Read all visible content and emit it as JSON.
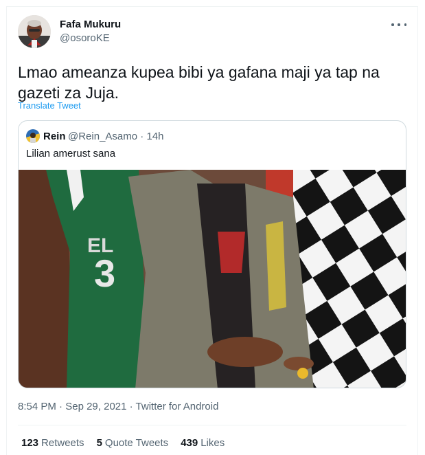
{
  "author": {
    "name": "Fafa Mukuru",
    "handle": "@osoroKE"
  },
  "tweet": {
    "text": "Lmao ameanza kupea bibi ya gafana maji ya tap na gazeti za Juja.",
    "translate_label": "Translate Tweet"
  },
  "quoted_tweet": {
    "name": "Rein",
    "handle": "@Rein_Asamo",
    "separator": "·",
    "time": "14h",
    "text": "Lilian amerust sana"
  },
  "meta": {
    "time": "8:54 PM",
    "separator": "·",
    "date": "Sep 29, 2021",
    "source": "Twitter for Android"
  },
  "stats": {
    "retweets_count": "123",
    "retweets_label": "Retweets",
    "quotes_count": "5",
    "quotes_label": "Quote Tweets",
    "likes_count": "439",
    "likes_label": "Likes"
  },
  "colors": {
    "text_primary": "#0f1419",
    "text_secondary": "#536471",
    "link": "#1d9bf0",
    "border": "#cfd9de"
  },
  "icons": {
    "more": "more-horizontal-icon"
  }
}
